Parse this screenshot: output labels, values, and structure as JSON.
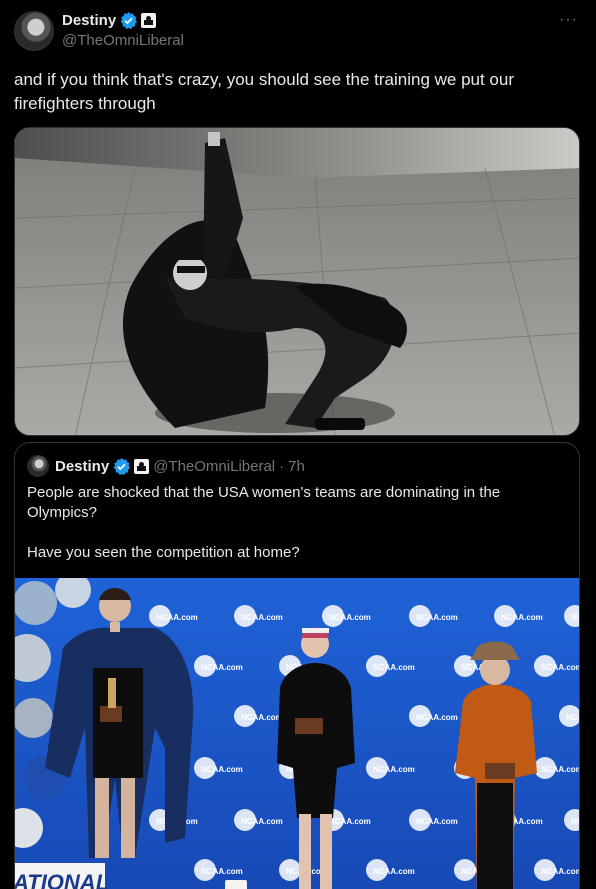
{
  "author": {
    "name": "Destiny",
    "handle": "@TheOmniLiberal",
    "more": "···"
  },
  "tweet": {
    "text": "and if you think that's crazy, you should see the training we put our firefighters through"
  },
  "quoted": {
    "name": "Destiny",
    "handle": "@TheOmniLiberal",
    "dot": "·",
    "time": "7h",
    "text_line1": "People are shocked that the USA women's teams are dominating in the Olympics?",
    "text_line2": "Have you seen the competition at home?"
  },
  "backdrop": {
    "logo": "NCAA.com",
    "banner": "ATIONAL"
  },
  "colors": {
    "verified": "#1d9bf0",
    "secondary_text": "#71767b",
    "border": "#2f3336",
    "backdrop_blue": "#1d5ad0"
  }
}
